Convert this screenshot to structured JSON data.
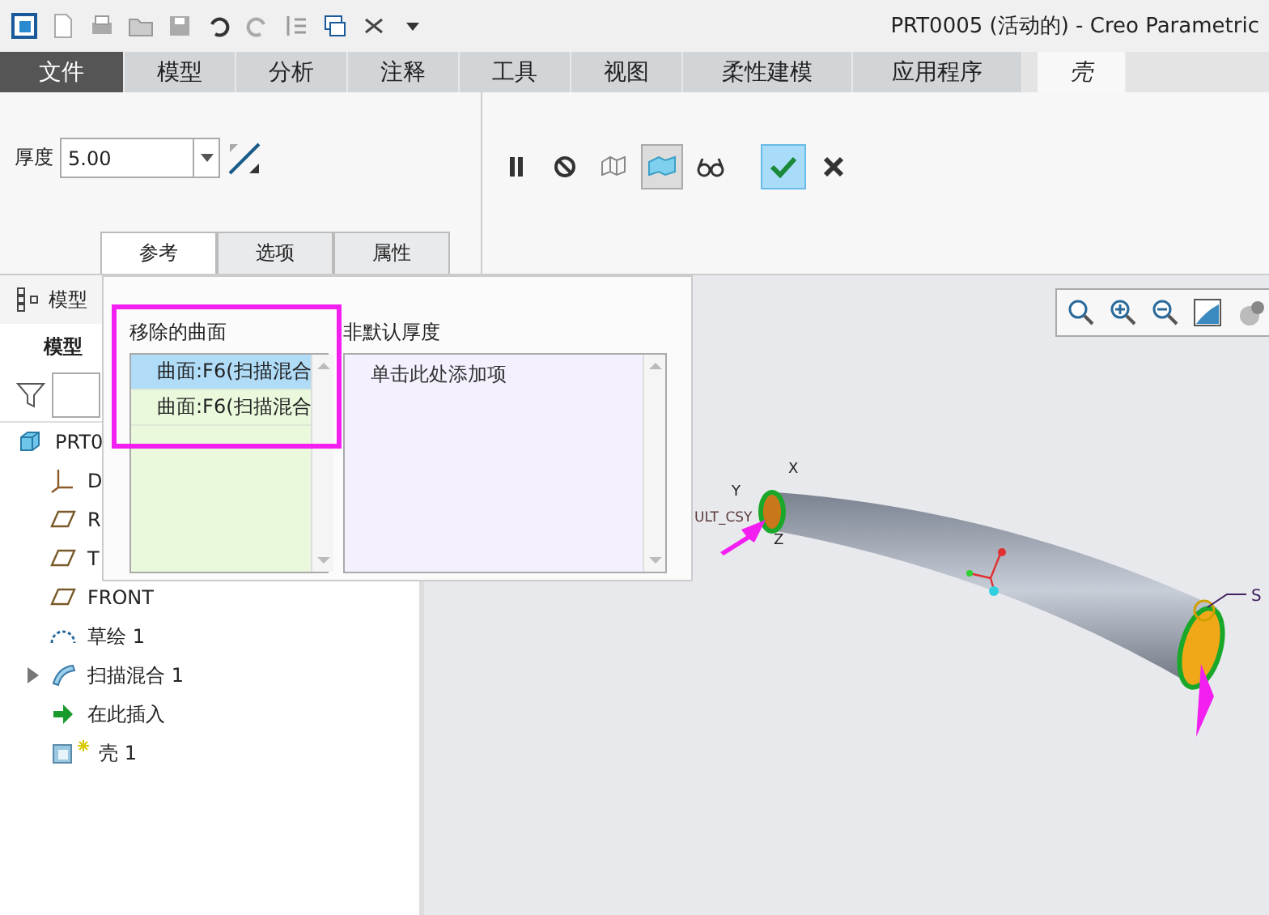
{
  "window": {
    "title": "PRT0005 (活动的) - Creo Parametric"
  },
  "ribbon_tabs": [
    {
      "label": "文件",
      "kind": "file",
      "selected": false
    },
    {
      "label": "模型",
      "kind": "tab",
      "selected": false
    },
    {
      "label": "分析",
      "kind": "tab",
      "selected": false
    },
    {
      "label": "注释",
      "kind": "tab",
      "selected": false
    },
    {
      "label": "工具",
      "kind": "tab",
      "selected": false
    },
    {
      "label": "视图",
      "kind": "tab",
      "selected": false
    },
    {
      "label": "柔性建模",
      "kind": "tab",
      "selected": false
    },
    {
      "label": "应用程序",
      "kind": "tab",
      "selected": false
    },
    {
      "label": "壳",
      "kind": "tab",
      "selected": true
    }
  ],
  "thickness": {
    "label": "厚度",
    "value": "5.00"
  },
  "shell_tools": [
    {
      "kind": "pause",
      "pressed": false
    },
    {
      "kind": "no-preview",
      "pressed": false
    },
    {
      "kind": "wireframe",
      "pressed": false
    },
    {
      "kind": "shaded",
      "pressed": true
    },
    {
      "kind": "glasses",
      "pressed": false
    },
    {
      "kind": "ok",
      "pressed": true
    },
    {
      "kind": "cancel",
      "pressed": false
    }
  ],
  "panel_tabs": [
    {
      "label": "参考",
      "selected": true
    },
    {
      "label": "选项",
      "selected": false
    },
    {
      "label": "属性",
      "selected": false
    }
  ],
  "references": {
    "removed_surfaces": {
      "label": "移除的曲面",
      "items": [
        {
          "label": "曲面:F6(扫描混合",
          "selected": true
        },
        {
          "label": "曲面:F6(扫描混合",
          "selected": false
        }
      ]
    },
    "non_default_thickness": {
      "label": "非默认厚度",
      "hint": "单击此处添加项"
    }
  },
  "model_tree": {
    "header": "模型",
    "title": "模型",
    "items": [
      {
        "label": "PRT0",
        "kind": "part"
      },
      {
        "label": "D",
        "kind": "csys"
      },
      {
        "label": "R",
        "kind": "plane"
      },
      {
        "label": "T",
        "kind": "plane"
      },
      {
        "label": "FRONT",
        "kind": "plane"
      },
      {
        "label": "草绘 1",
        "kind": "sketch"
      },
      {
        "label": "扫描混合 1",
        "kind": "sweep",
        "expanded": false
      },
      {
        "label": "在此插入",
        "kind": "insert"
      },
      {
        "label": "壳 1",
        "kind": "shell"
      }
    ]
  },
  "viewport": {
    "labels": [
      "X",
      "Y",
      "Z",
      "ULT_CSY",
      "S"
    ]
  }
}
